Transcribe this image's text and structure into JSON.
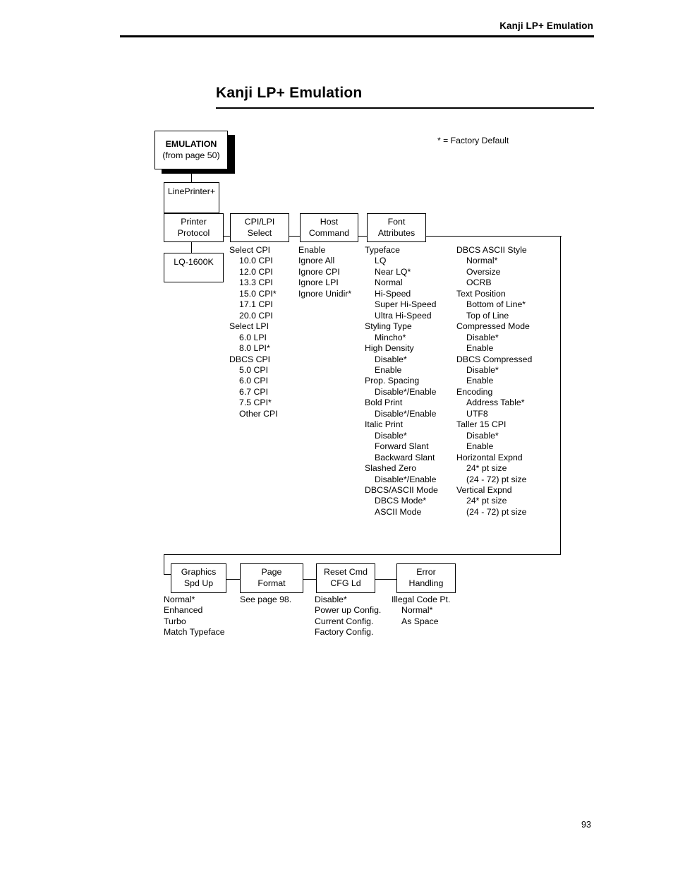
{
  "header": {
    "running_title": "Kanji LP+ Emulation"
  },
  "page": {
    "title": "Kanji LP+ Emulation",
    "number": "93"
  },
  "legend": {
    "factory_default_note": "* = Factory Default"
  },
  "diagram": {
    "root": {
      "title": "EMULATION",
      "subtitle": "(from page 50)"
    },
    "nodes": {
      "lineprinter": "LinePrinter+",
      "printer_protocol_l1": "Printer",
      "printer_protocol_l2": "Protocol",
      "lq1600k": "LQ-1600K",
      "cpi_lpi_l1": "CPI/LPI",
      "cpi_lpi_l2": "Select",
      "host_cmd_l1": "Host",
      "host_cmd_l2": "Command",
      "font_attr_l1": "Font",
      "font_attr_l2": "Attributes",
      "graphics_l1": "Graphics",
      "graphics_l2": "Spd Up",
      "page_format_l1": "Page",
      "page_format_l2": "Format",
      "reset_cmd_l1": "Reset Cmd",
      "reset_cmd_l2": "CFG Ld",
      "error_handling_l1": "Error",
      "error_handling_l2": "Handling"
    },
    "columns": {
      "cpi_lpi_select": [
        {
          "label": "Select CPI",
          "level": 1
        },
        {
          "label": "10.0 CPI",
          "level": 2
        },
        {
          "label": "12.0 CPI",
          "level": 2
        },
        {
          "label": "13.3 CPI",
          "level": 2
        },
        {
          "label": "15.0 CPI*",
          "level": 2
        },
        {
          "label": "17.1 CPI",
          "level": 2
        },
        {
          "label": "20.0 CPI",
          "level": 2
        },
        {
          "label": "Select LPI",
          "level": 1
        },
        {
          "label": "6.0 LPI",
          "level": 2
        },
        {
          "label": "8.0 LPI*",
          "level": 2
        },
        {
          "label": "DBCS CPI",
          "level": 1
        },
        {
          "label": "5.0 CPI",
          "level": 2
        },
        {
          "label": "6.0 CPI",
          "level": 2
        },
        {
          "label": "6.7 CPI",
          "level": 2
        },
        {
          "label": "7.5 CPI*",
          "level": 2
        },
        {
          "label": "Other CPI",
          "level": 2
        }
      ],
      "host_command": [
        {
          "label": "Enable",
          "level": 1
        },
        {
          "label": "Ignore All",
          "level": 1
        },
        {
          "label": "Ignore CPI",
          "level": 1
        },
        {
          "label": "Ignore LPI",
          "level": 1
        },
        {
          "label": "Ignore Unidir*",
          "level": 1
        }
      ],
      "font_attributes_left": [
        {
          "label": "Typeface",
          "level": 1
        },
        {
          "label": "LQ",
          "level": 2
        },
        {
          "label": "Near LQ*",
          "level": 2
        },
        {
          "label": "Normal",
          "level": 2
        },
        {
          "label": "Hi-Speed",
          "level": 2
        },
        {
          "label": "Super Hi-Speed",
          "level": 2
        },
        {
          "label": "Ultra Hi-Speed",
          "level": 2
        },
        {
          "label": "Styling Type",
          "level": 1
        },
        {
          "label": "Mincho*",
          "level": 2
        },
        {
          "label": "High Density",
          "level": 1
        },
        {
          "label": "Disable*",
          "level": 2
        },
        {
          "label": "Enable",
          "level": 2
        },
        {
          "label": "Prop. Spacing",
          "level": 1
        },
        {
          "label": "Disable*/Enable",
          "level": 2
        },
        {
          "label": "Bold Print",
          "level": 1
        },
        {
          "label": "Disable*/Enable",
          "level": 2
        },
        {
          "label": "Italic Print",
          "level": 1
        },
        {
          "label": "Disable*",
          "level": 2
        },
        {
          "label": "Forward Slant",
          "level": 2
        },
        {
          "label": "Backward Slant",
          "level": 2
        },
        {
          "label": "Slashed Zero",
          "level": 1
        },
        {
          "label": "Disable*/Enable",
          "level": 2
        },
        {
          "label": "DBCS/ASCII Mode",
          "level": 1
        },
        {
          "label": "DBCS Mode*",
          "level": 2
        },
        {
          "label": "ASCII Mode",
          "level": 2
        }
      ],
      "font_attributes_right": [
        {
          "label": "DBCS ASCII Style",
          "level": 1
        },
        {
          "label": "Normal*",
          "level": 2
        },
        {
          "label": "Oversize",
          "level": 2
        },
        {
          "label": "OCRB",
          "level": 2
        },
        {
          "label": "Text Position",
          "level": 1
        },
        {
          "label": "Bottom of Line*",
          "level": 2
        },
        {
          "label": "Top of Line",
          "level": 2
        },
        {
          "label": "Compressed Mode",
          "level": 1
        },
        {
          "label": "Disable*",
          "level": 2
        },
        {
          "label": "Enable",
          "level": 2
        },
        {
          "label": "DBCS Compressed",
          "level": 1
        },
        {
          "label": "Disable*",
          "level": 2
        },
        {
          "label": "Enable",
          "level": 2
        },
        {
          "label": "Encoding",
          "level": 1
        },
        {
          "label": "Address Table*",
          "level": 2
        },
        {
          "label": "UTF8",
          "level": 2
        },
        {
          "label": "Taller 15 CPI",
          "level": 1
        },
        {
          "label": "Disable*",
          "level": 2
        },
        {
          "label": "Enable",
          "level": 2
        },
        {
          "label": "Horizontal Expnd",
          "level": 1
        },
        {
          "label": "24* pt size",
          "level": 2
        },
        {
          "label": "(24 - 72) pt size",
          "level": 2
        },
        {
          "label": "Vertical Expnd",
          "level": 1
        },
        {
          "label": "24* pt size",
          "level": 2
        },
        {
          "label": "(24 - 72) pt size",
          "level": 2
        }
      ],
      "graphics_spd_up": [
        {
          "label": "Normal*",
          "level": 1
        },
        {
          "label": "Enhanced",
          "level": 1
        },
        {
          "label": "Turbo",
          "level": 1
        },
        {
          "label": "Match Typeface",
          "level": 1
        }
      ],
      "page_format": [
        {
          "label": "See page 98.",
          "level": 1
        }
      ],
      "reset_cmd_cfg_ld": [
        {
          "label": "Disable*",
          "level": 1
        },
        {
          "label": "Power up Config.",
          "level": 1
        },
        {
          "label": "Current Config.",
          "level": 1
        },
        {
          "label": "Factory Config.",
          "level": 1
        }
      ],
      "error_handling": [
        {
          "label": "Illegal Code Pt.",
          "level": 1
        },
        {
          "label": "Normal*",
          "level": 2
        },
        {
          "label": "As Space",
          "level": 2
        }
      ]
    }
  }
}
